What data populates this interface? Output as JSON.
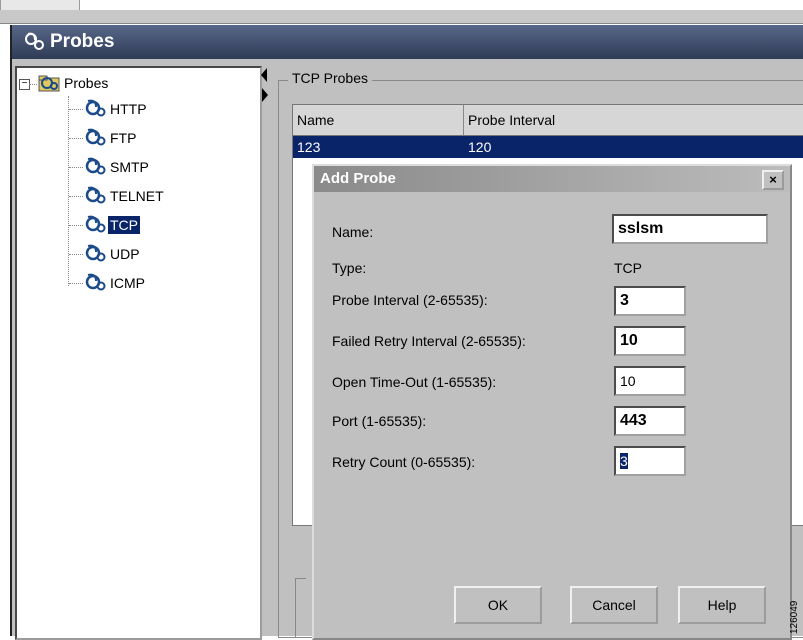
{
  "header": {
    "title": "Probes",
    "icon": "probe-icon"
  },
  "tree": {
    "root": {
      "label": "Probes",
      "icon": "folder-probe-icon",
      "expander": "−"
    },
    "items": [
      {
        "label": "HTTP",
        "selected": false
      },
      {
        "label": "FTP",
        "selected": false
      },
      {
        "label": "SMTP",
        "selected": false
      },
      {
        "label": "TELNET",
        "selected": false
      },
      {
        "label": "TCP",
        "selected": true
      },
      {
        "label": "UDP",
        "selected": false
      },
      {
        "label": "ICMP",
        "selected": false
      }
    ]
  },
  "panel": {
    "group_title": "TCP Probes",
    "table": {
      "columns": [
        "Name",
        "Probe Interval"
      ],
      "rows": [
        {
          "name": "123",
          "interval": "120"
        }
      ]
    }
  },
  "dialog": {
    "title": "Add Probe",
    "close": "×",
    "fields": {
      "name_label": "Name:",
      "name_value": "sslsm",
      "type_label": "Type:",
      "type_value": "TCP",
      "probe_interval_label": "Probe Interval (2-65535):",
      "probe_interval_value": "3",
      "failed_retry_label": "Failed Retry Interval (2-65535):",
      "failed_retry_value": "10",
      "open_timeout_label": "Open Time-Out (1-65535):",
      "open_timeout_value": "10",
      "port_label": "Port (1-65535):",
      "port_value": "443",
      "retry_count_label": "Retry Count (0-65535):",
      "retry_count_value": "3"
    },
    "buttons": {
      "ok": "OK",
      "cancel": "Cancel",
      "help": "Help"
    }
  },
  "figure_number": "126049",
  "colors": {
    "selection": "#0a246a",
    "header": "#3a4868",
    "window": "#c0c0c0"
  }
}
